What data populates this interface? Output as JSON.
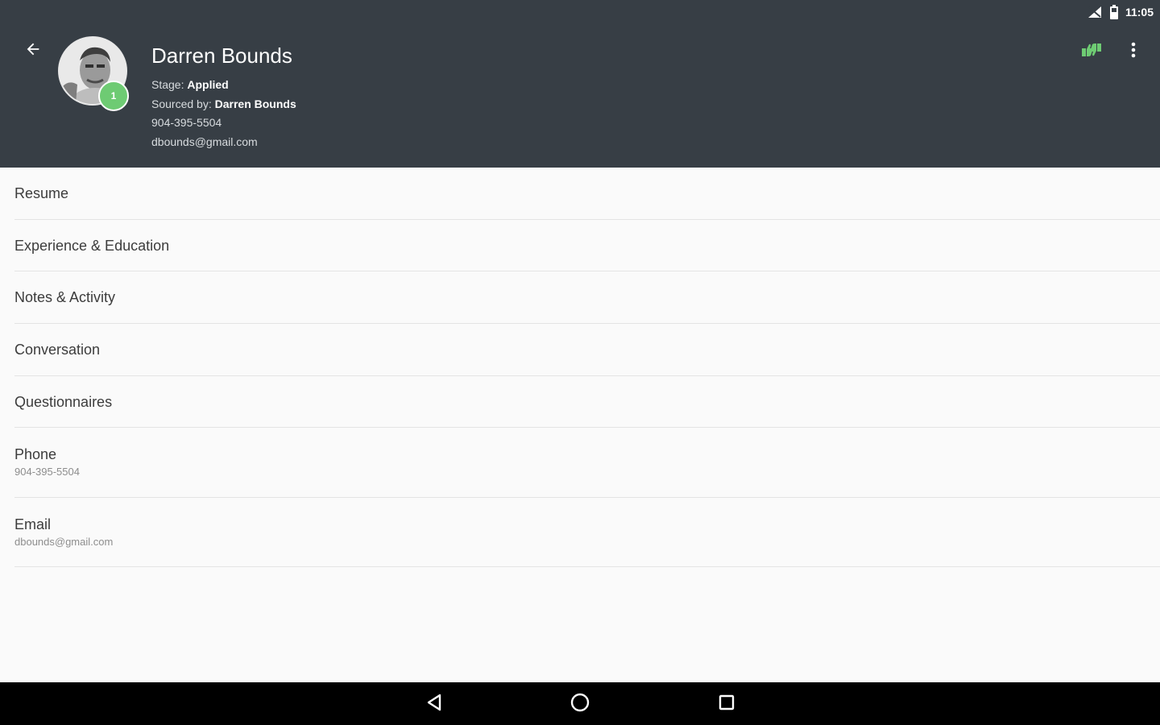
{
  "status_bar": {
    "time": "11:05",
    "icons": [
      "signal-icon",
      "battery-icon"
    ]
  },
  "header": {
    "back_icon": "arrow-back-icon",
    "avatar_badge": "1",
    "name": "Darren Bounds",
    "stage_label": "Stage:",
    "stage_value": "Applied",
    "sourced_label": "Sourced by:",
    "sourced_value": "Darren Bounds",
    "phone": "904-395-5504",
    "email": "dbounds@gmail.com",
    "actions": [
      "thumbs-icon",
      "more-vert-icon"
    ],
    "colors": {
      "background": "#373e45",
      "accent": "#6ecb73"
    }
  },
  "list": {
    "items": [
      {
        "label": "Resume"
      },
      {
        "label": "Experience & Education"
      },
      {
        "label": "Notes & Activity"
      },
      {
        "label": "Conversation"
      },
      {
        "label": "Questionnaires"
      },
      {
        "label": "Phone",
        "sub": "904-395-5504"
      },
      {
        "label": "Email",
        "sub": "dbounds@gmail.com"
      }
    ]
  },
  "nav_bar": {
    "buttons": [
      "back-triangle-icon",
      "home-circle-icon",
      "recents-square-icon"
    ]
  }
}
